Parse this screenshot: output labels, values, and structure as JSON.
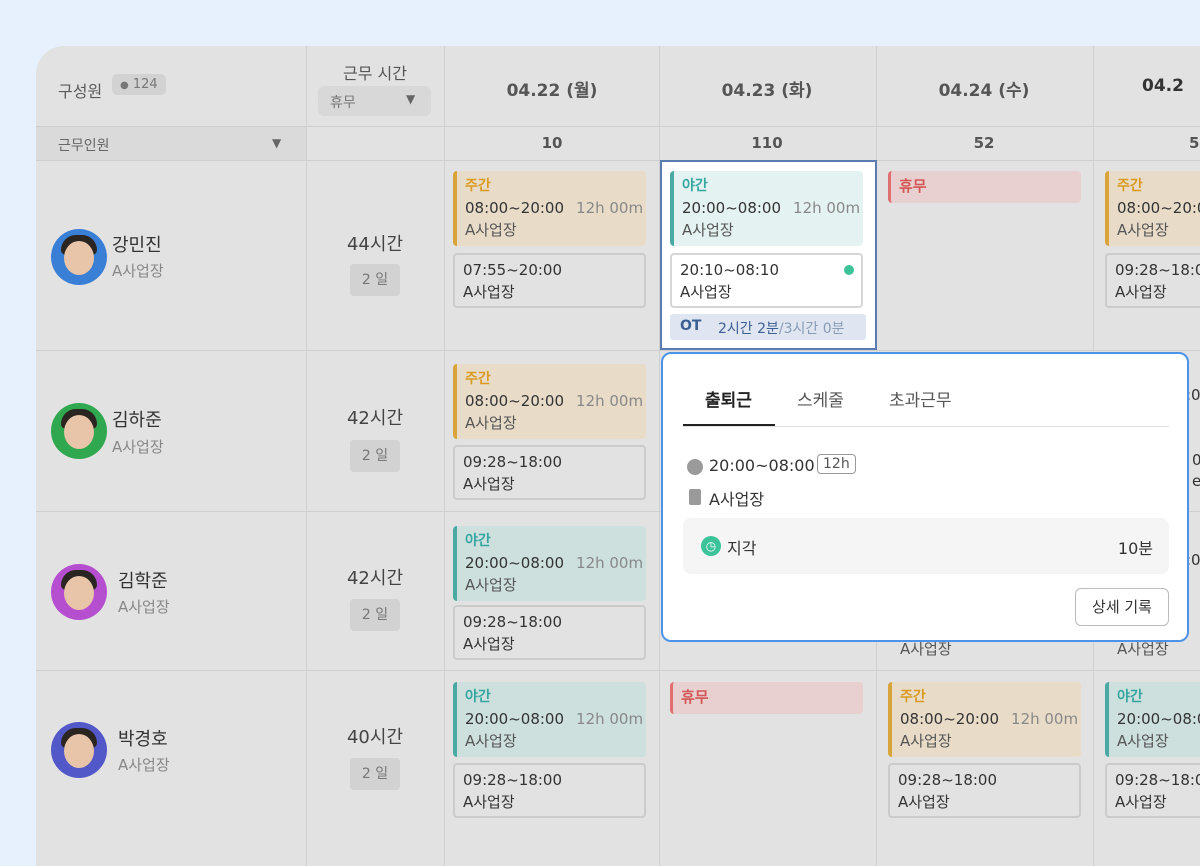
{
  "header": {
    "members_label": "구성원",
    "member_count": "124",
    "work_time_label": "근무 시간",
    "work_time_filter": "휴무",
    "staff_filter": "근무인원"
  },
  "dates": [
    {
      "label": "04.22 (월)",
      "count": "10"
    },
    {
      "label": "04.23 (화)",
      "count": "110"
    },
    {
      "label": "04.24 (수)",
      "count": "52"
    },
    {
      "label": "04.2",
      "count": "5"
    }
  ],
  "members": [
    {
      "name": "강민진",
      "org": "A사업장",
      "hours": "44시간",
      "days": "2 일"
    },
    {
      "name": "김하준",
      "org": "A사업장",
      "hours": "42시간",
      "days": "2 일"
    },
    {
      "name": "김학준",
      "org": "A사업장",
      "hours": "42시간",
      "days": "2 일"
    },
    {
      "name": "박경호",
      "org": "A사업장",
      "hours": "40시간",
      "days": "2 일"
    }
  ],
  "labels": {
    "day": "주간",
    "night": "야간",
    "rest": "휴무",
    "dur": "12h 00m",
    "loc": "A사업장",
    "t_day": "08:00~20:00",
    "t_night": "20:00~08:00",
    "r1": "07:55~20:00",
    "r2": "09:28~18:00",
    "r3": "20:10~08:10",
    "ot_label": "OT",
    "ot_value": "2시간 2분",
    "ot_total": "/3시간 0분",
    "clipped_t_day": "08:00~20:0",
    "clipped_r": "09:28~18:0",
    "clipped_loc": "A사업장",
    "clipped_hidden_0": ":0",
    "clipped_hidden_1": "0",
    "clipped_hidden_2": "e",
    "clipped_hidden_3": ":0",
    "clipped_a": "A사업장",
    "clipped_day_r": "09:28~18:0"
  },
  "popup": {
    "tabs": [
      "출퇴근",
      "스케줄",
      "초과근무"
    ],
    "time": "20:00~08:00",
    "time_badge": "12h",
    "location": "A사업장",
    "status": "지각",
    "status_value": "10분",
    "button": "상세 기록"
  },
  "colors": {
    "accent": "#4d94e8",
    "day": "#d99a1f",
    "night": "#35a6a0",
    "rest": "#d45757"
  }
}
